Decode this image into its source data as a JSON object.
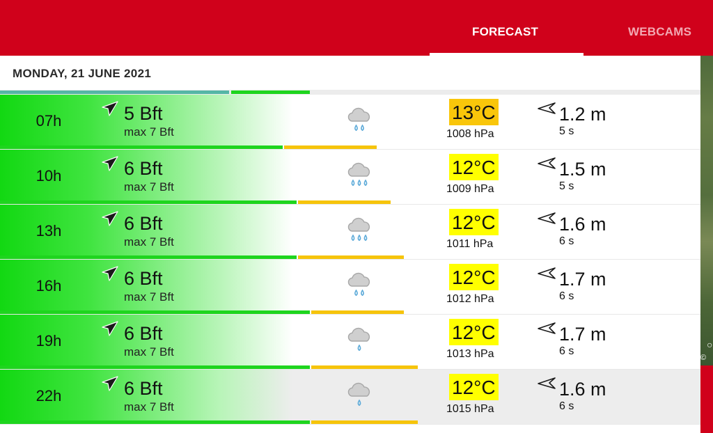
{
  "tabs": {
    "forecast": "FORECAST",
    "webcams": "WEBCAMS"
  },
  "date_label": "MONDAY, 21 JUNE 2021",
  "map": {
    "copyright": "©",
    "scale_glyph": "○"
  },
  "day_bar": [
    {
      "start": 0,
      "end": 0.327,
      "color": "#55b6a6"
    },
    {
      "start": 0.33,
      "end": 0.442,
      "color": "#1ed51e"
    }
  ],
  "colors": {
    "wind_green": "#1ed51e",
    "gradient_green": "#12d812",
    "temp_highlight_orange": "#f9c60a",
    "temp_highlight_yellow": "#ffff00",
    "rain_blue": "#5aa9d8",
    "cloud_grey": "#a8a8a8"
  },
  "rows": [
    {
      "hour": "07h",
      "bft": "5 Bft",
      "max": "max 7 Bft",
      "wind_dir_deg": 225,
      "weather": "cloud-rain-2-icon",
      "drops": 2,
      "temp": "13°C",
      "temp_bg": "#f9c60a",
      "pressure": "1008 hPa",
      "wave_height": "1.2 m",
      "wave_period": "5 s",
      "wave_dir_deg": 240,
      "wind_bar": 0.404,
      "rain_bar_start": 0.406,
      "rain_bar_end": 0.538,
      "selected": false
    },
    {
      "hour": "10h",
      "bft": "6 Bft",
      "max": "max 7 Bft",
      "wind_dir_deg": 225,
      "weather": "cloud-rain-3-icon",
      "drops": 3,
      "temp": "12°C",
      "temp_bg": "#ffff00",
      "pressure": "1009 hPa",
      "wave_height": "1.5 m",
      "wave_period": "5 s",
      "wave_dir_deg": 240,
      "wind_bar": 0.423,
      "rain_bar_start": 0.425,
      "rain_bar_end": 0.558,
      "selected": false
    },
    {
      "hour": "13h",
      "bft": "6 Bft",
      "max": "max 7 Bft",
      "wind_dir_deg": 225,
      "weather": "cloud-rain-3-icon",
      "drops": 3,
      "temp": "12°C",
      "temp_bg": "#ffff00",
      "pressure": "1011 hPa",
      "wave_height": "1.6 m",
      "wave_period": "6 s",
      "wave_dir_deg": 240,
      "wind_bar": 0.423,
      "rain_bar_start": 0.425,
      "rain_bar_end": 0.577,
      "selected": false
    },
    {
      "hour": "16h",
      "bft": "6 Bft",
      "max": "max 7 Bft",
      "wind_dir_deg": 225,
      "weather": "cloud-rain-2-icon",
      "drops": 2,
      "temp": "12°C",
      "temp_bg": "#ffff00",
      "pressure": "1012 hPa",
      "wave_height": "1.7 m",
      "wave_period": "6 s",
      "wave_dir_deg": 240,
      "wind_bar": 0.442,
      "rain_bar_start": 0.444,
      "rain_bar_end": 0.577,
      "selected": false
    },
    {
      "hour": "19h",
      "bft": "6 Bft",
      "max": "max 7 Bft",
      "wind_dir_deg": 225,
      "weather": "cloud-rain-1-icon",
      "drops": 1,
      "temp": "12°C",
      "temp_bg": "#ffff00",
      "pressure": "1013 hPa",
      "wave_height": "1.7 m",
      "wave_period": "6 s",
      "wave_dir_deg": 240,
      "wind_bar": 0.442,
      "rain_bar_start": 0.444,
      "rain_bar_end": 0.596,
      "selected": false
    },
    {
      "hour": "22h",
      "bft": "6 Bft",
      "max": "max 7 Bft",
      "wind_dir_deg": 225,
      "weather": "cloud-rain-1-icon",
      "drops": 1,
      "temp": "12°C",
      "temp_bg": "#ffff00",
      "pressure": "1015 hPa",
      "wave_height": "1.6 m",
      "wave_period": "6 s",
      "wave_dir_deg": 240,
      "wind_bar": 0.442,
      "rain_bar_start": 0.444,
      "rain_bar_end": 0.596,
      "selected": true
    }
  ]
}
